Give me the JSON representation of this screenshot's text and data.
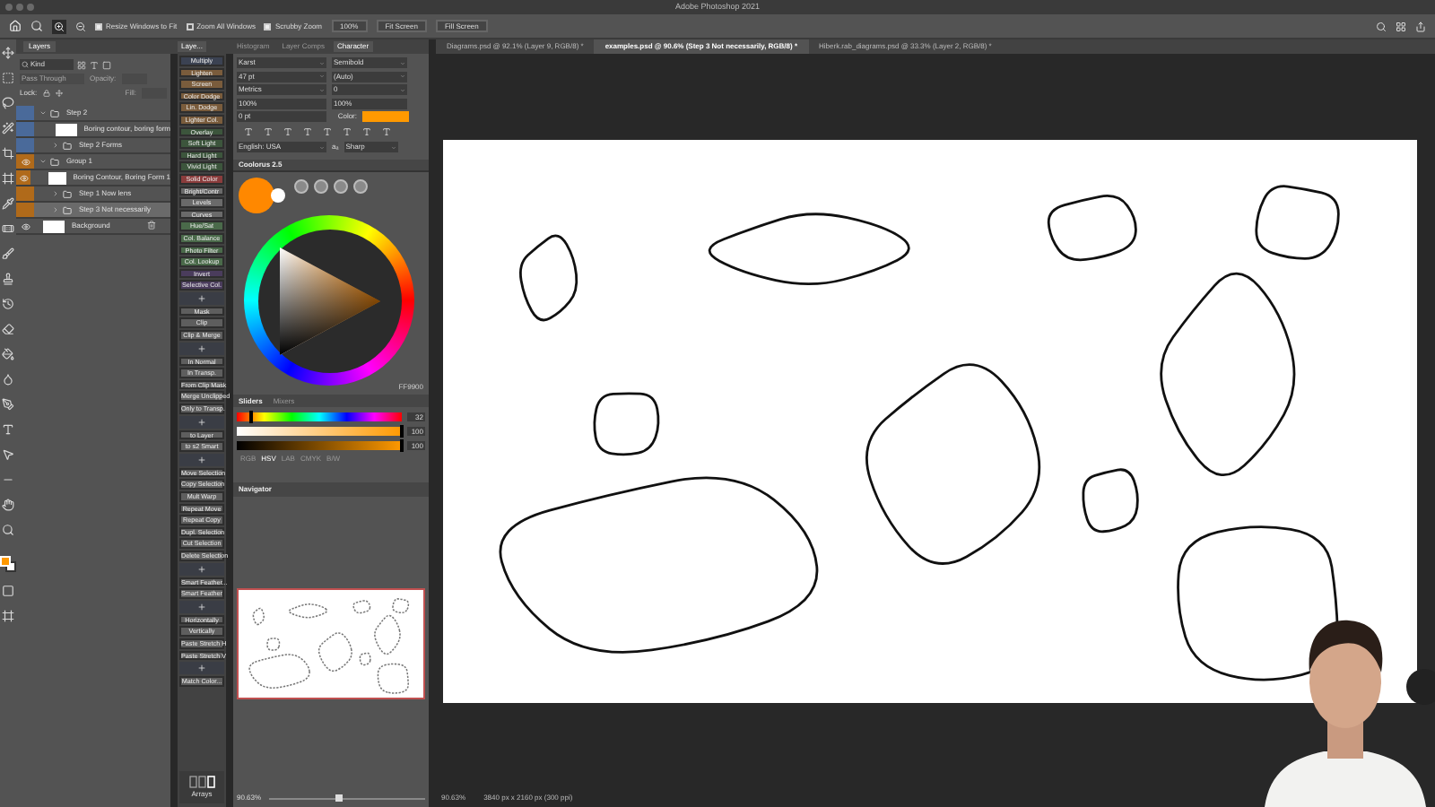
{
  "window": {
    "title": "Adobe Photoshop 2021"
  },
  "options_bar": {
    "checkboxes": [
      {
        "label": "Resize Windows to Fit",
        "checked": true
      },
      {
        "label": "Zoom All Windows",
        "checked": false
      },
      {
        "label": "Scrubby Zoom",
        "checked": true
      }
    ],
    "buttons": [
      "100%",
      "Fit Screen",
      "Fill Screen"
    ]
  },
  "panel_tabs": [
    {
      "label": "Layers",
      "selected": true
    },
    {
      "label": "Laye...",
      "selected": true
    },
    {
      "label": "Histogram",
      "selected": false
    },
    {
      "label": "Layer Comps",
      "selected": false
    },
    {
      "label": "Character",
      "selected": true
    }
  ],
  "document_tabs": [
    {
      "label": "Diagrams.psd @ 92.1% (Layer 9, RGB/8) *",
      "selected": false
    },
    {
      "label": "examples.psd @ 90.6% (Step 3 Not necessarily, RGB/8) *",
      "selected": true
    },
    {
      "label": "Hiberk.rab_diagrams.psd @ 33.3% (Layer 2, RGB/8) *",
      "selected": false
    }
  ],
  "layers": {
    "filter": "Kind",
    "blend_mode": "Pass Through",
    "opacity_label": "Opacity:",
    "lock_label": "Lock:",
    "fill_label": "Fill:",
    "items": [
      {
        "name": "Step 2",
        "kind": "group",
        "visible": false,
        "selected": false,
        "color": "#4a6a9a",
        "children": [
          {
            "name": "Boring contour, boring form",
            "kind": "layer",
            "visible": false,
            "selected": false,
            "color": "#4a6a9a"
          },
          {
            "name": "Step 2 Forms",
            "kind": "group",
            "visible": false,
            "selected": false,
            "color": "#4a6a9a"
          }
        ]
      },
      {
        "name": "Group 1",
        "kind": "group",
        "visible": true,
        "selected": false,
        "color": "#b06a1a",
        "children": [
          {
            "name": "Boring Contour, Boring Form 1",
            "kind": "layer",
            "visible": true,
            "selected": false,
            "color": "#b06a1a"
          },
          {
            "name": "Step 1 Now lens",
            "kind": "group",
            "visible": false,
            "selected": false,
            "color": "#b06a1a"
          },
          {
            "name": "Step 3 Not necessarily",
            "kind": "group",
            "visible": false,
            "selected": true,
            "color": "#b06a1a"
          }
        ]
      },
      {
        "name": "Background",
        "kind": "layer",
        "visible": true,
        "selected": false,
        "color": "#535353"
      }
    ]
  },
  "actions": [
    {
      "kind": "button",
      "label": "Multiply",
      "color": "#3b4252"
    },
    {
      "kind": "button",
      "label": "Lighten",
      "color": "#7a5c3c"
    },
    {
      "kind": "button",
      "label": "Screen",
      "color": "#7a5c3c"
    },
    {
      "kind": "button",
      "label": "Color Dodge",
      "color": "#7a5c3c"
    },
    {
      "kind": "button",
      "label": "Lin. Dodge",
      "color": "#7a5c3c"
    },
    {
      "kind": "button",
      "label": "Lighter Col.",
      "color": "#7a5c3c"
    },
    {
      "kind": "button",
      "label": "Overlay",
      "color": "#3c553c"
    },
    {
      "kind": "button",
      "label": "Soft Light",
      "color": "#3c553c"
    },
    {
      "kind": "button",
      "label": "Hard Light",
      "color": "#3c553c"
    },
    {
      "kind": "button",
      "label": "Vivid Light",
      "color": "#3c553c"
    },
    {
      "kind": "button",
      "label": "Solid Color",
      "color": "#8a3c3c"
    },
    {
      "kind": "button",
      "label": "Bright/Contr",
      "color": "#6a6a6a"
    },
    {
      "kind": "button",
      "label": "Levels",
      "color": "#6a6a6a"
    },
    {
      "kind": "button",
      "label": "Curves",
      "color": "#6a6a6a"
    },
    {
      "kind": "button",
      "label": "Hue/Sat",
      "color": "#4a6a4a"
    },
    {
      "kind": "button",
      "label": "Col. Balance",
      "color": "#4a6a4a"
    },
    {
      "kind": "button",
      "label": "Photo Filter",
      "color": "#4a6a4a"
    },
    {
      "kind": "button",
      "label": "Col. Lookup",
      "color": "#4a6a4a"
    },
    {
      "kind": "button",
      "label": "Invert",
      "color": "#4a3c5c"
    },
    {
      "kind": "button",
      "label": "Selective Col.",
      "color": "#4a3c5c"
    },
    {
      "kind": "icon"
    },
    {
      "kind": "button",
      "label": "Mask",
      "color": "#5e5e5e"
    },
    {
      "kind": "button",
      "label": "Clip",
      "color": "#5e5e5e"
    },
    {
      "kind": "button",
      "label": "Clip & Merge",
      "color": "#5e5e5e"
    },
    {
      "kind": "icon"
    },
    {
      "kind": "button",
      "label": "In Normal",
      "color": "#5e5e5e"
    },
    {
      "kind": "button",
      "label": "In Transp.",
      "color": "#5e5e5e"
    },
    {
      "kind": "button",
      "label": "From Clip Mask",
      "color": "#5e5e5e"
    },
    {
      "kind": "button",
      "label": "Merge Unclipped",
      "color": "#5e5e5e"
    },
    {
      "kind": "button",
      "label": "Only to Transp.",
      "color": "#5e5e5e"
    },
    {
      "kind": "icon"
    },
    {
      "kind": "button",
      "label": "to Layer",
      "color": "#5e5e5e"
    },
    {
      "kind": "button",
      "label": "to s2 Smart",
      "color": "#5e5e5e"
    },
    {
      "kind": "icon"
    },
    {
      "kind": "button",
      "label": "Move Selection",
      "color": "#5e5e5e"
    },
    {
      "kind": "button",
      "label": "Copy Selection",
      "color": "#5e5e5e"
    },
    {
      "kind": "button",
      "label": "Mult Warp",
      "color": "#5e5e5e"
    },
    {
      "kind": "button",
      "label": "Repeat Move",
      "color": "#5e5e5e"
    },
    {
      "kind": "button",
      "label": "Repeat Copy",
      "color": "#5e5e5e"
    },
    {
      "kind": "button",
      "label": "Dupl. Selection",
      "color": "#5e5e5e"
    },
    {
      "kind": "button",
      "label": "Cut Selection",
      "color": "#5e5e5e"
    },
    {
      "kind": "button",
      "label": "Delete Selection",
      "color": "#5e5e5e"
    },
    {
      "kind": "icon"
    },
    {
      "kind": "button",
      "label": "Smart Feather...",
      "color": "#5e5e5e"
    },
    {
      "kind": "button",
      "label": "Smart Feather",
      "color": "#5e5e5e"
    },
    {
      "kind": "icon"
    },
    {
      "kind": "button",
      "label": "Horizontally",
      "color": "#5e5e5e"
    },
    {
      "kind": "button",
      "label": "Vertically",
      "color": "#5e5e5e"
    },
    {
      "kind": "button",
      "label": "Paste Stretch H",
      "color": "#5e5e5e"
    },
    {
      "kind": "button",
      "label": "Paste Stretch V",
      "color": "#5e5e5e"
    },
    {
      "kind": "icon"
    },
    {
      "kind": "button",
      "label": "Match Color...",
      "color": "#5e5e5e"
    }
  ],
  "arrays_label": "Arrays",
  "character": {
    "font": "Karst",
    "style": "Semibold",
    "size": "47 pt",
    "leading": "(Auto)",
    "kerning": "Metrics",
    "tracking": "0",
    "vscale": "100%",
    "hscale": "100%",
    "baseline": "0 pt",
    "color_label": "Color:",
    "language": "English: USA",
    "aa_label": "aₐ",
    "antialias": "Sharp"
  },
  "coolorus": {
    "title": "Coolorus 2.5",
    "hex": "FF9900"
  },
  "slider_tabs": [
    {
      "label": "Sliders",
      "selected": true
    },
    {
      "label": "Mixers",
      "selected": false
    }
  ],
  "sliders": [
    {
      "kind": "hue",
      "level": 0.09,
      "reading": "32"
    },
    {
      "kind": "saturation",
      "level": 1,
      "reading": "100"
    },
    {
      "kind": "brightness",
      "level": 1,
      "reading": "100"
    }
  ],
  "color_modes": [
    {
      "label": "RGB",
      "selected": false
    },
    {
      "label": "HSV",
      "selected": true
    },
    {
      "label": "LAB",
      "selected": false
    },
    {
      "label": "CMYK",
      "selected": false
    },
    {
      "label": "B/W",
      "selected": false
    }
  ],
  "navigator": {
    "title": "Navigator",
    "zoom": "90.63%",
    "level": 0.45
  },
  "status_bar": {
    "zoom": "90.63%",
    "info": "3840 px x 2160 px (300 ppi)"
  }
}
